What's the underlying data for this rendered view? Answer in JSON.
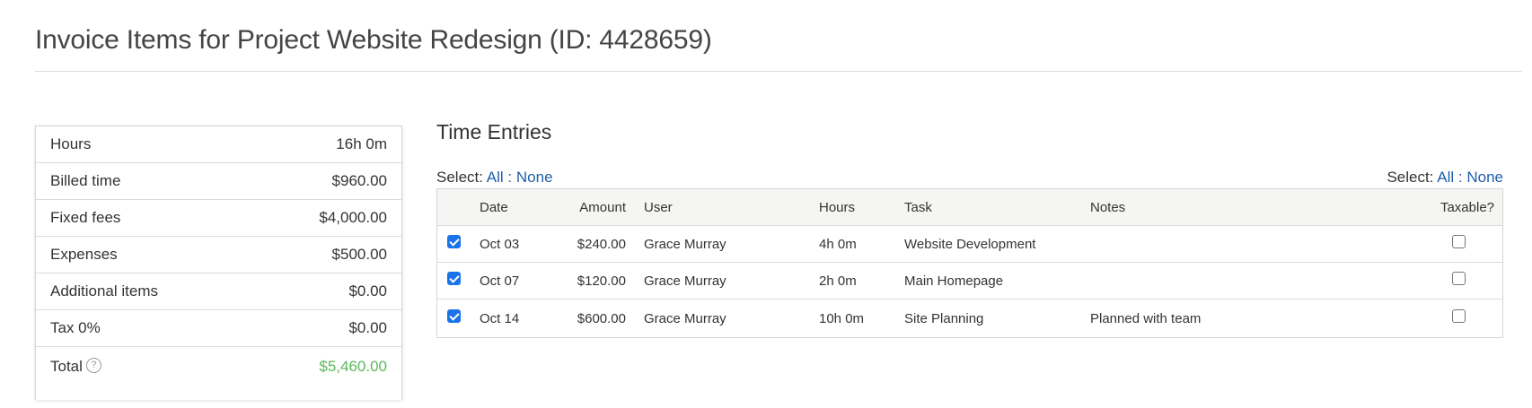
{
  "page": {
    "title": "Invoice Items for Project Website Redesign (ID: 4428659)"
  },
  "summary": {
    "rows": [
      {
        "label": "Hours",
        "value": "16h 0m"
      },
      {
        "label": "Billed time",
        "value": "$960.00"
      },
      {
        "label": "Fixed fees",
        "value": "$4,000.00"
      },
      {
        "label": "Expenses",
        "value": "$500.00"
      },
      {
        "label": "Additional items",
        "value": "$0.00"
      },
      {
        "label": "Tax 0%",
        "value": "$0.00"
      }
    ],
    "total": {
      "label": "Total",
      "value": "$5,460.00",
      "help_glyph": "?",
      "color": "#5cb85c"
    }
  },
  "time_entries": {
    "title": "Time Entries",
    "select": {
      "prefix": "Select:",
      "all": "All",
      "separator": ":",
      "none": "None"
    },
    "columns": {
      "date": "Date",
      "amount": "Amount",
      "user": "User",
      "hours": "Hours",
      "task": "Task",
      "notes": "Notes",
      "taxable": "Taxable?"
    },
    "rows": [
      {
        "checked": true,
        "date": "Oct 03",
        "amount": "$240.00",
        "user": "Grace Murray",
        "hours": "4h 0m",
        "task": "Website Development",
        "notes": "",
        "taxable": false
      },
      {
        "checked": true,
        "date": "Oct 07",
        "amount": "$120.00",
        "user": "Grace Murray",
        "hours": "2h 0m",
        "task": "Main Homepage",
        "notes": "",
        "taxable": false
      },
      {
        "checked": true,
        "date": "Oct 14",
        "amount": "$600.00",
        "user": "Grace Murray",
        "hours": "10h 0m",
        "task": "Site Planning",
        "notes": "Planned with team",
        "taxable": false
      }
    ]
  },
  "colors": {
    "link": "#1f5faa",
    "checkbox_checked": "#1a73e8",
    "total": "#5cb85c",
    "header_bg": "#f5f5f3"
  }
}
